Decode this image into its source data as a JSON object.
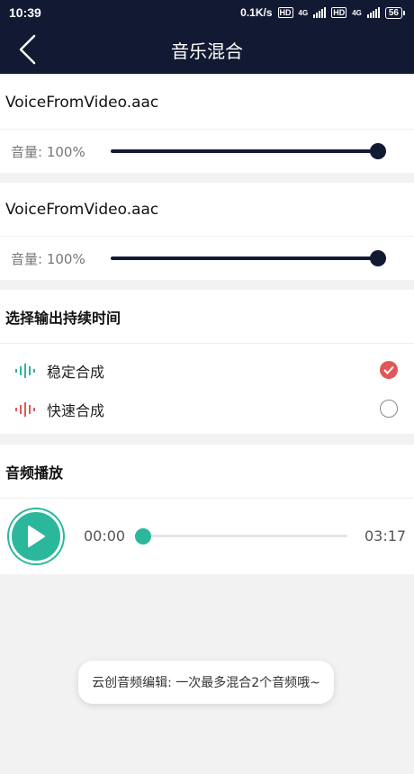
{
  "status_bar": {
    "time": "10:39",
    "net_speed": "0.1K/s",
    "hd1": "HD",
    "net1": "4G",
    "hd2": "HD",
    "net2": "4G",
    "battery": "56"
  },
  "nav": {
    "title": "音乐混合",
    "back_icon": "chevron-left-icon"
  },
  "tracks": [
    {
      "name": "VoiceFromVideo.aac",
      "volume_label": "音量: 100%",
      "volume_fraction": 1.0
    },
    {
      "name": "VoiceFromVideo.aac",
      "volume_label": "音量: 100%",
      "volume_fraction": 1.0
    }
  ],
  "duration": {
    "title": "选择输出持续时间",
    "options": [
      {
        "label": "稳定合成",
        "icon": "waveform-icon",
        "icon_color": "#2bb79b",
        "selected": true
      },
      {
        "label": "快速合成",
        "icon": "waveform-icon",
        "icon_color": "#e0575a",
        "selected": false
      }
    ]
  },
  "playback": {
    "title": "音频播放",
    "current_time": "00:00",
    "total_time": "03:17",
    "progress_fraction": 0.0,
    "play_icon": "play-icon"
  },
  "toast": {
    "message": "云创音频编辑: 一次最多混合2个音频哦~"
  },
  "colors": {
    "header": "#121a33",
    "accent": "#2bb79b",
    "check": "#e0575a"
  }
}
